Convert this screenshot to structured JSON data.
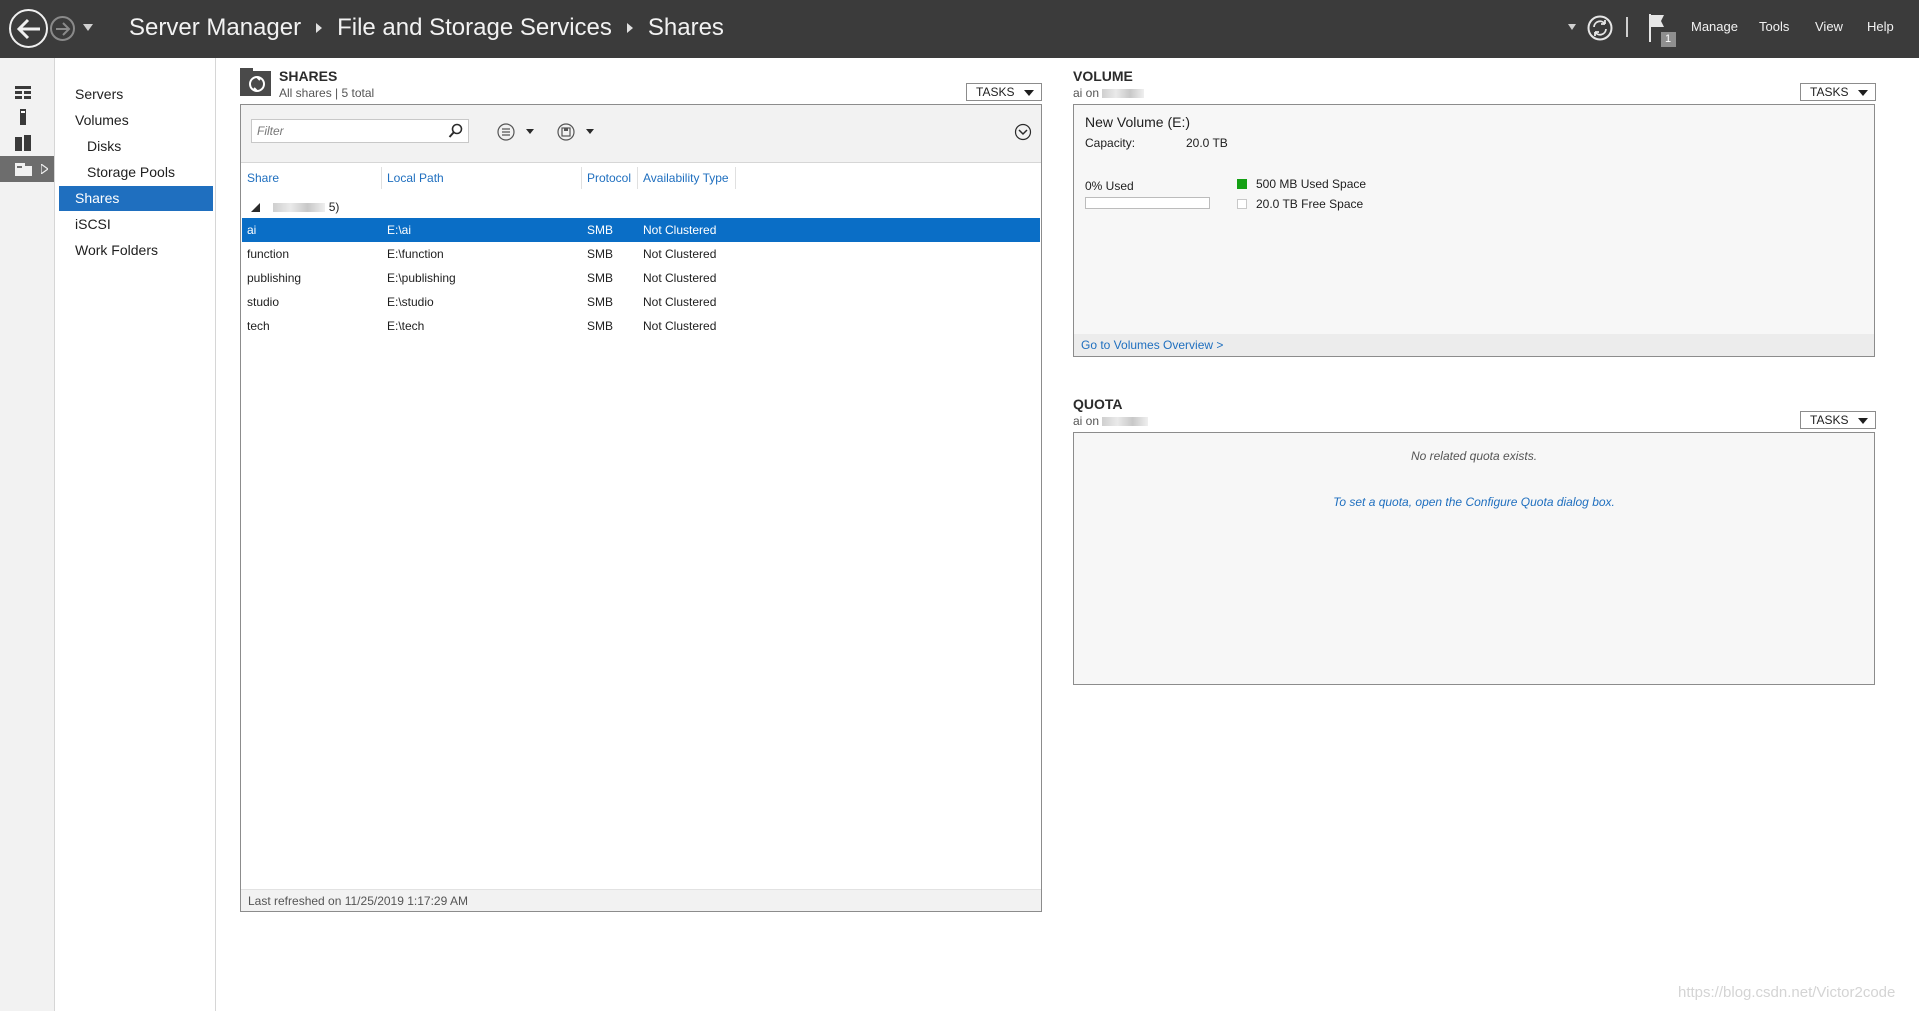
{
  "window": {
    "breadcrumb": [
      "Server Manager",
      "File and Storage Services",
      "Shares"
    ],
    "menu": [
      "Manage",
      "Tools",
      "View",
      "Help"
    ],
    "flag_count": "1"
  },
  "sidebar": {
    "items": [
      {
        "label": "Servers"
      },
      {
        "label": "Volumes"
      },
      {
        "label": "Disks"
      },
      {
        "label": "Storage Pools"
      },
      {
        "label": "Shares",
        "active": true
      },
      {
        "label": "iSCSI"
      },
      {
        "label": "Work Folders"
      }
    ]
  },
  "shares": {
    "title": "SHARES",
    "subtitle": "All shares | 5 total",
    "tasks_label": "TASKS",
    "filter_placeholder": "Filter",
    "columns": [
      "Share",
      "Local Path",
      "Protocol",
      "Availability Type"
    ],
    "group_label_suffix": "5)",
    "rows": [
      {
        "share": "ai",
        "path": "E:\\ai",
        "protocol": "SMB",
        "availability": "Not Clustered",
        "selected": true
      },
      {
        "share": "function",
        "path": "E:\\function",
        "protocol": "SMB",
        "availability": "Not Clustered"
      },
      {
        "share": "publishing",
        "path": "E:\\publishing",
        "protocol": "SMB",
        "availability": "Not Clustered"
      },
      {
        "share": "studio",
        "path": "E:\\studio",
        "protocol": "SMB",
        "availability": "Not Clustered"
      },
      {
        "share": "tech",
        "path": "E:\\tech",
        "protocol": "SMB",
        "availability": "Not Clustered"
      }
    ],
    "status": "Last refreshed on 11/25/2019 1:17:29 AM"
  },
  "volume": {
    "title": "VOLUME",
    "subtitle": "ai on",
    "tasks_label": "TASKS",
    "name": "New Volume (E:)",
    "capacity_label": "Capacity:",
    "capacity_value": "20.0 TB",
    "used_label": "0% Used",
    "used_fraction": 0,
    "legend_used": "500 MB Used Space",
    "legend_free": "20.0 TB Free Space",
    "used_color": "#14a014",
    "link": "Go to Volumes Overview >"
  },
  "quota": {
    "title": "QUOTA",
    "subtitle": "ai on",
    "tasks_label": "TASKS",
    "message": "No related quota exists.",
    "hint": "To set a quota, open the Configure Quota dialog box."
  },
  "colors": {
    "titlebar": "#3b3b3b",
    "accent": "#1f6fbf",
    "selected_row": "#0a6ec6"
  },
  "watermark": "https://blog.csdn.net/Victor2code"
}
